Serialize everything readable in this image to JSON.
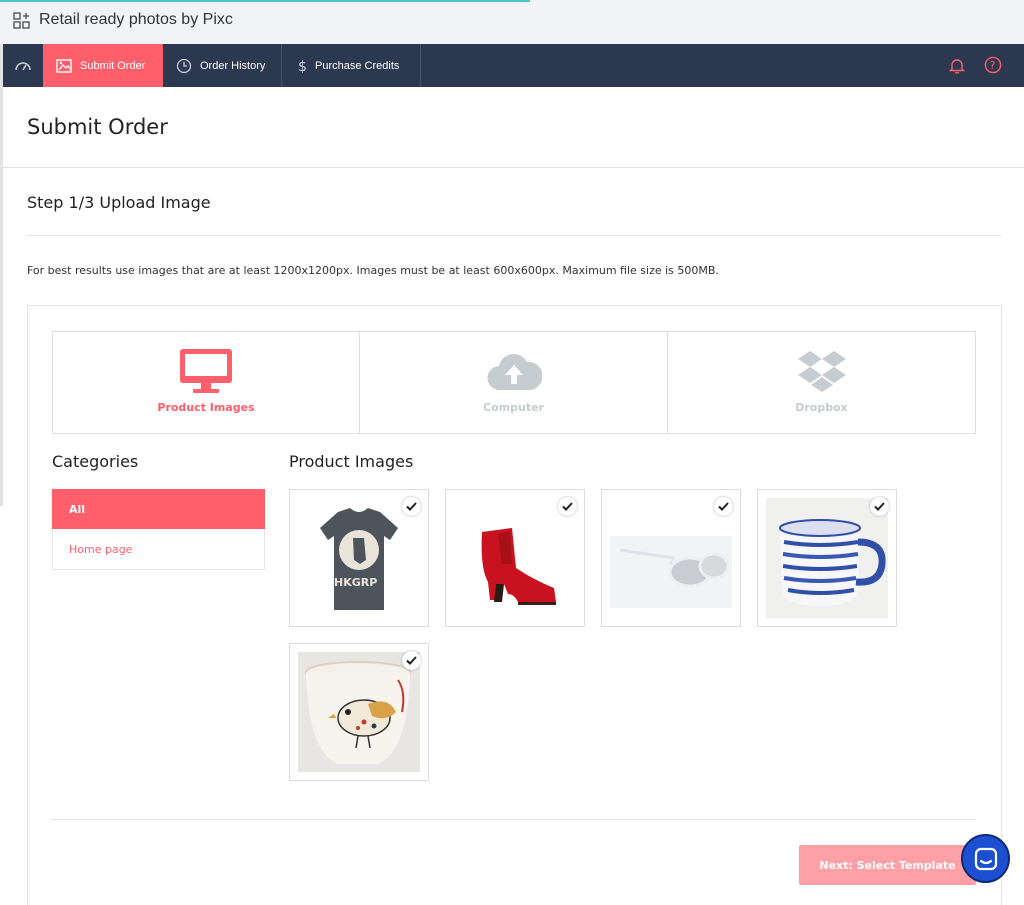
{
  "window": {
    "title": "Retail ready photos by Pixc"
  },
  "nav": {
    "tabs": [
      {
        "label": "Submit Order",
        "active": true
      },
      {
        "label": "Order History",
        "active": false
      },
      {
        "label": "Purchase Credits",
        "active": false
      }
    ]
  },
  "header": {
    "title": "Submit Order"
  },
  "step": {
    "title": "Step 1/3 Upload Image",
    "info": "For best results use images that are at least 1200x1200px. Images must be at least 600x600px. Maximum file size is 500MB."
  },
  "sources": [
    {
      "label": "Product Images",
      "selected": true
    },
    {
      "label": "Computer",
      "selected": false
    },
    {
      "label": "Dropbox",
      "selected": false
    }
  ],
  "categories": {
    "title": "Categories",
    "items": [
      {
        "label": "All",
        "active": true
      },
      {
        "label": "Home page",
        "active": false
      }
    ]
  },
  "product_images": {
    "title": "Product Images",
    "items": [
      {
        "name": "t-shirt",
        "checked": true,
        "print": "HKGRP"
      },
      {
        "name": "red-boot",
        "checked": true
      },
      {
        "name": "sunglasses",
        "checked": true
      },
      {
        "name": "striped-mug",
        "checked": true
      },
      {
        "name": "bird-cup",
        "checked": true
      }
    ]
  },
  "footer": {
    "next_label": "Next: Select Template"
  },
  "colors": {
    "accent": "#ff5e6b",
    "nav_bg": "#2c3850",
    "button_disabled": "#ffa0a7",
    "chat": "#1d4fd1",
    "muted_icon": "#c5cdd1"
  }
}
